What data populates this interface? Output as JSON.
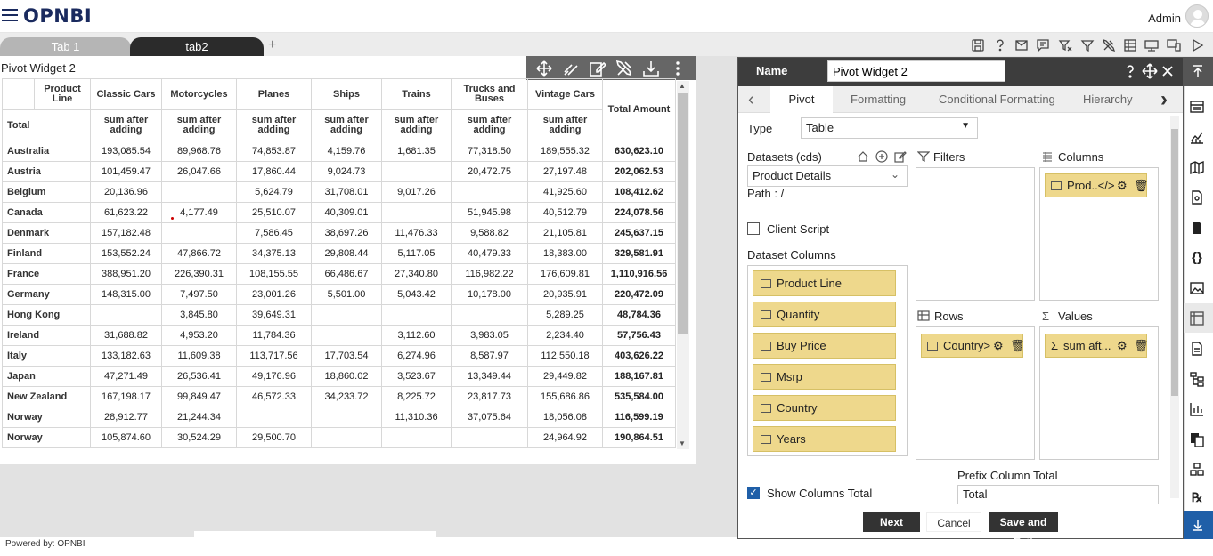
{
  "app": {
    "logo": "OPNBI",
    "user": "Admin",
    "footer": "Powered by: OPNBI"
  },
  "tabs": [
    {
      "label": "Tab 1"
    },
    {
      "label": "tab2"
    }
  ],
  "tab_add": "+",
  "widget": {
    "title": "Pivot Widget 2"
  },
  "pivot": {
    "corner_top": "Product Line",
    "corner_bottom": "Total",
    "columns": [
      "Classic Cars",
      "Motorcycles",
      "Planes",
      "Ships",
      "Trains",
      "Trucks and Buses",
      "Vintage Cars"
    ],
    "measure": "sum after adding",
    "total_header": "Total Amount",
    "rows": [
      {
        "label": "Australia",
        "values": [
          "193,085.54",
          "89,968.76",
          "74,853.87",
          "4,159.76",
          "1,681.35",
          "77,318.50",
          "189,555.32"
        ],
        "total": "630,623.10"
      },
      {
        "label": "Austria",
        "values": [
          "101,459.47",
          "26,047.66",
          "17,860.44",
          "9,024.73",
          "",
          "20,472.75",
          "27,197.48"
        ],
        "total": "202,062.53"
      },
      {
        "label": "Belgium",
        "values": [
          "20,136.96",
          "",
          "5,624.79",
          "31,708.01",
          "9,017.26",
          "",
          "41,925.60"
        ],
        "total": "108,412.62"
      },
      {
        "label": "Canada",
        "values": [
          "61,623.22",
          "4,177.49",
          "25,510.07",
          "40,309.01",
          "",
          "51,945.98",
          "40,512.79"
        ],
        "total": "224,078.56"
      },
      {
        "label": "Denmark",
        "values": [
          "157,182.48",
          "",
          "7,586.45",
          "38,697.26",
          "11,476.33",
          "9,588.82",
          "21,105.81"
        ],
        "total": "245,637.15"
      },
      {
        "label": "Finland",
        "values": [
          "153,552.24",
          "47,866.72",
          "34,375.13",
          "29,808.44",
          "5,117.05",
          "40,479.33",
          "18,383.00"
        ],
        "total": "329,581.91"
      },
      {
        "label": "France",
        "values": [
          "388,951.20",
          "226,390.31",
          "108,155.55",
          "66,486.67",
          "27,340.80",
          "116,982.22",
          "176,609.81"
        ],
        "total": "1,110,916.56"
      },
      {
        "label": "Germany",
        "values": [
          "148,315.00",
          "7,497.50",
          "23,001.26",
          "5,501.00",
          "5,043.42",
          "10,178.00",
          "20,935.91"
        ],
        "total": "220,472.09"
      },
      {
        "label": "Hong Kong",
        "values": [
          "",
          "3,845.80",
          "39,649.31",
          "",
          "",
          "",
          "5,289.25"
        ],
        "total": "48,784.36"
      },
      {
        "label": "Ireland",
        "values": [
          "31,688.82",
          "4,953.20",
          "11,784.36",
          "",
          "3,112.60",
          "3,983.05",
          "2,234.40"
        ],
        "total": "57,756.43"
      },
      {
        "label": "Italy",
        "values": [
          "133,182.63",
          "11,609.38",
          "113,717.56",
          "17,703.54",
          "6,274.96",
          "8,587.97",
          "112,550.18"
        ],
        "total": "403,626.22"
      },
      {
        "label": "Japan",
        "values": [
          "47,271.49",
          "26,536.41",
          "49,176.96",
          "18,860.02",
          "3,523.67",
          "13,349.44",
          "29,449.82"
        ],
        "total": "188,167.81"
      },
      {
        "label": "New Zealand",
        "values": [
          "167,198.17",
          "99,849.47",
          "46,572.33",
          "34,233.72",
          "8,225.72",
          "23,817.73",
          "155,686.86"
        ],
        "total": "535,584.00"
      },
      {
        "label": "Norway ",
        "values": [
          "28,912.77",
          "21,244.34",
          "",
          "",
          "11,310.36",
          "37,075.64",
          "18,056.08"
        ],
        "total": "116,599.19"
      },
      {
        "label": "Norway",
        "values": [
          "105,874.60",
          "30,524.29",
          "29,500.70",
          "",
          "",
          "",
          "24,964.92"
        ],
        "total": "190,864.51"
      }
    ]
  },
  "panel": {
    "name_label": "Name",
    "name_value": "Pivot Widget 2",
    "tabs": [
      "Pivot",
      "Formatting",
      "Conditional Formatting",
      "Hierarchy"
    ],
    "type_label": "Type",
    "type_value": "Table",
    "datasets_label": "Datasets (cds)",
    "dataset_value": "Product Details",
    "path_label": "Path :",
    "path_value": "/",
    "client_script": "Client Script",
    "dataset_columns_label": "Dataset Columns",
    "dataset_columns": [
      "Product Line",
      "Quantity",
      "Buy Price",
      "Msrp",
      "Country",
      "Years"
    ],
    "filters_label": "Filters",
    "columns_label": "Columns",
    "columns_chip": "Prod..</>",
    "rows_label": "Rows",
    "rows_chip": "Country>",
    "values_label": "Values",
    "values_chip": "sum aft...",
    "show_columns_total": "Show Columns Total",
    "prefix_total_label": "Prefix Column Total",
    "prefix_total_value": "Total",
    "buttons": {
      "next": "Next",
      "cancel": "Cancel",
      "save_exit": "Save and Exit"
    }
  },
  "colors": {
    "accent": "#1f5fa8",
    "chip": "#eed88c",
    "header": "#3d3d3d",
    "brand": "#1a2a5e"
  }
}
